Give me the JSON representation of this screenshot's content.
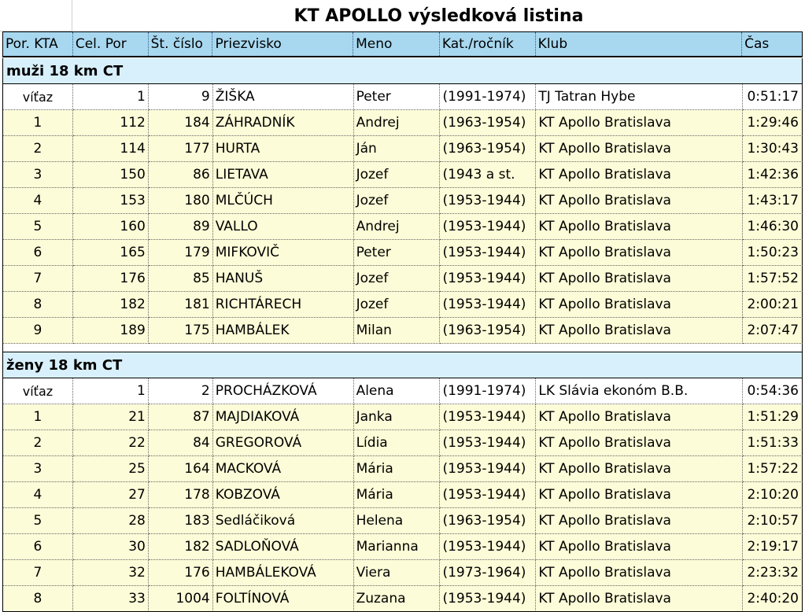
{
  "title": "KT APOLLO výsledková listina",
  "columns": [
    "Por. KTA",
    "Cel. Por",
    "Št. číslo",
    "Priezvisko",
    "Meno",
    "Kat./ročník",
    "Klub",
    "Čas"
  ],
  "sections": [
    {
      "name": "muži 18 km CT",
      "rows": [
        {
          "por": "víťaz",
          "cel": "1",
          "cislo": "9",
          "priezvisko": "ŽIŠKA",
          "meno": "Peter",
          "kat": "(1991-1974)",
          "klub": "TJ Tatran Hybe",
          "cas": "0:51:17"
        },
        {
          "por": "1",
          "cel": "112",
          "cislo": "184",
          "priezvisko": "ZÁHRADNÍK",
          "meno": "Andrej",
          "kat": "(1963-1954)",
          "klub": "KT Apollo Bratislava",
          "cas": "1:29:46"
        },
        {
          "por": "2",
          "cel": "114",
          "cislo": "177",
          "priezvisko": "HURTA",
          "meno": "Ján",
          "kat": "(1963-1954)",
          "klub": "KT Apollo Bratislava",
          "cas": "1:30:43"
        },
        {
          "por": "3",
          "cel": "150",
          "cislo": "86",
          "priezvisko": "LIETAVA",
          "meno": "Jozef",
          "kat": "(1943 a st.",
          "klub": "KT Apollo Bratislava",
          "cas": "1:42:36"
        },
        {
          "por": "4",
          "cel": "153",
          "cislo": "180",
          "priezvisko": "MLČÚCH",
          "meno": "Jozef",
          "kat": "(1953-1944)",
          "klub": "KT Apollo Bratislava",
          "cas": "1:43:17"
        },
        {
          "por": "5",
          "cel": "160",
          "cislo": "89",
          "priezvisko": "VALLO",
          "meno": "Andrej",
          "kat": "(1953-1944)",
          "klub": "KT Apollo Bratislava",
          "cas": "1:46:30"
        },
        {
          "por": "6",
          "cel": "165",
          "cislo": "179",
          "priezvisko": "MIFKOVIČ",
          "meno": "Peter",
          "kat": "(1953-1944)",
          "klub": "KT Apollo Bratislava",
          "cas": "1:50:23"
        },
        {
          "por": "7",
          "cel": "176",
          "cislo": "85",
          "priezvisko": "HANUŠ",
          "meno": "Jozef",
          "kat": "(1953-1944)",
          "klub": "KT Apollo Bratislava",
          "cas": "1:57:52"
        },
        {
          "por": "8",
          "cel": "182",
          "cislo": "181",
          "priezvisko": "RICHTÁRECH",
          "meno": "Jozef",
          "kat": "(1953-1944)",
          "klub": "KT Apollo Bratislava",
          "cas": "2:00:21"
        },
        {
          "por": "9",
          "cel": "189",
          "cislo": "175",
          "priezvisko": "HAMBÁLEK",
          "meno": "Milan",
          "kat": "(1963-1954)",
          "klub": "KT Apollo Bratislava",
          "cas": "2:07:47"
        }
      ]
    },
    {
      "name": "ženy 18 km CT",
      "rows": [
        {
          "por": "víťaz",
          "cel": "1",
          "cislo": "2",
          "priezvisko": "PROCHÁZKOVÁ",
          "meno": "Alena",
          "kat": "(1991-1974)",
          "klub": "LK Slávia ekonóm B.B.",
          "cas": "0:54:36"
        },
        {
          "por": "1",
          "cel": "21",
          "cislo": "87",
          "priezvisko": "MAJDIAKOVÁ",
          "meno": "Janka",
          "kat": "(1953-1944)",
          "klub": "KT Apollo Bratislava",
          "cas": "1:51:29"
        },
        {
          "por": "2",
          "cel": "22",
          "cislo": "84",
          "priezvisko": "GREGOROVÁ",
          "meno": "Lídia",
          "kat": "(1953-1944)",
          "klub": "KT Apollo Bratislava",
          "cas": "1:51:33"
        },
        {
          "por": "3",
          "cel": "25",
          "cislo": "164",
          "priezvisko": "MACKOVÁ",
          "meno": "Mária",
          "kat": "(1953-1944)",
          "klub": "KT Apollo Bratislava",
          "cas": "1:57:22"
        },
        {
          "por": "4",
          "cel": "27",
          "cislo": "178",
          "priezvisko": "KOBZOVÁ",
          "meno": "Mária",
          "kat": "(1953-1944)",
          "klub": "KT Apollo Bratislava",
          "cas": "2:10:20"
        },
        {
          "por": "5",
          "cel": "28",
          "cislo": "183",
          "priezvisko": "Sedláčiková",
          "meno": "Helena",
          "kat": "(1963-1954)",
          "klub": "KT Apollo Bratislava",
          "cas": "2:10:57"
        },
        {
          "por": "6",
          "cel": "30",
          "cislo": "182",
          "priezvisko": "SADLOŇOVÁ",
          "meno": "Marianna",
          "kat": "(1953-1944)",
          "klub": "KT Apollo Bratislava",
          "cas": "2:19:17"
        },
        {
          "por": "7",
          "cel": "32",
          "cislo": "176",
          "priezvisko": "HAMBÁLEKOVÁ",
          "meno": "Viera",
          "kat": "(1973-1964)",
          "klub": "KT Apollo Bratislava",
          "cas": "2:23:32"
        },
        {
          "por": "8",
          "cel": "33",
          "cislo": "1004",
          "priezvisko": "FOLTÍNOVÁ",
          "meno": "Zuzana",
          "kat": "(1953-1944)",
          "klub": "KT Apollo Bratislava",
          "cas": "2:40:20"
        }
      ]
    }
  ]
}
